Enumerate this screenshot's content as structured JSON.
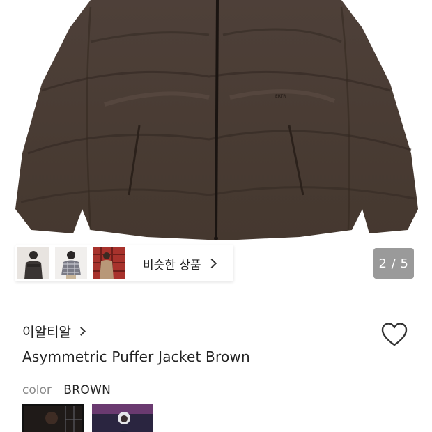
{
  "gallery": {
    "current_page": 2,
    "total_pages": 5,
    "counter_text": "2 / 5",
    "jacket_color": "#4b3d36",
    "thumbnails": [
      {
        "name": "model-front-dark"
      },
      {
        "name": "model-checked-jacket"
      },
      {
        "name": "model-red-background"
      }
    ],
    "similar_label": "비슷한 상품"
  },
  "product": {
    "brand": "이알티알",
    "title": "Asymmetric Puffer Jacket Brown",
    "color_label": "color",
    "color_value": "BROWN",
    "swatches": [
      {
        "name": "brown-option",
        "selected": true
      },
      {
        "name": "navy-option",
        "selected": false
      }
    ]
  },
  "icons": {
    "wishlist": "heart-outline-icon",
    "brand_chevron": "chevron-right-icon",
    "similar_chevron": "chevron-right-icon"
  }
}
